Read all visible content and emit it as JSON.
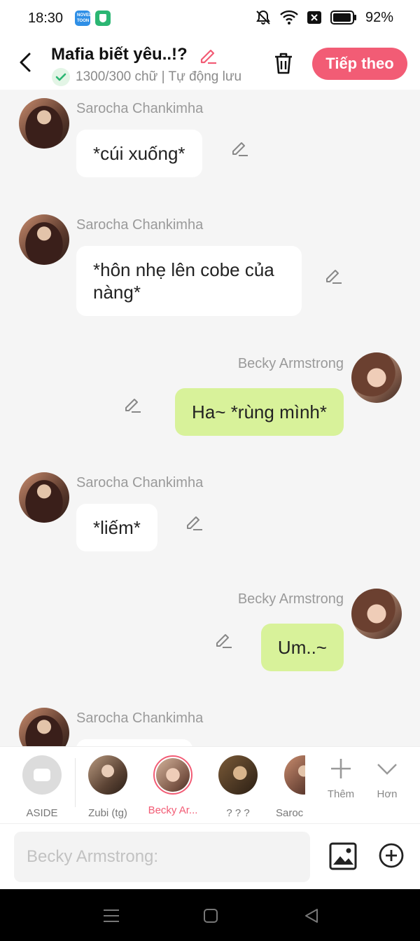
{
  "status_bar": {
    "time": "18:30",
    "app_icon_1_text": "NOVEL TOON",
    "battery": "92%",
    "icons": [
      "notifications-off-icon",
      "wifi-icon",
      "sim-off-icon",
      "battery-icon"
    ]
  },
  "header": {
    "title": "Mafia biết yêu..!?",
    "subtitle": "1300/300 chữ | Tự động lưu",
    "next_label": "Tiếp theo"
  },
  "messages": [
    {
      "sender": "Sarocha Chankimha",
      "side": "left",
      "text": "*cúi xuống*"
    },
    {
      "sender": "Sarocha Chankimha",
      "side": "left",
      "text": "*hôn nhẹ lên cobe của nàng*"
    },
    {
      "sender": "Becky Armstrong",
      "side": "right",
      "text": "Ha~ *rùng mình*"
    },
    {
      "sender": "Sarocha Chankimha",
      "side": "left",
      "text": "*liếm*"
    },
    {
      "sender": "Becky Armstrong",
      "side": "right",
      "text": "Um..~"
    },
    {
      "sender": "Sarocha Chankimha",
      "side": "left",
      "text": ""
    }
  ],
  "characters": [
    {
      "label": "ASIDE"
    },
    {
      "label": "Zubi (tg)"
    },
    {
      "label": "Becky Ar..."
    },
    {
      "label": "? ? ?"
    },
    {
      "label": "Saroc"
    }
  ],
  "tools": {
    "add_label": "Thêm",
    "more_label": "Hơn"
  },
  "composer": {
    "placeholder": "Becky Armstrong:"
  },
  "colors": {
    "accent": "#f25c75",
    "right_bubble": "#d8f29a",
    "left_bubble": "#ffffff",
    "background": "#f5f5f5"
  }
}
